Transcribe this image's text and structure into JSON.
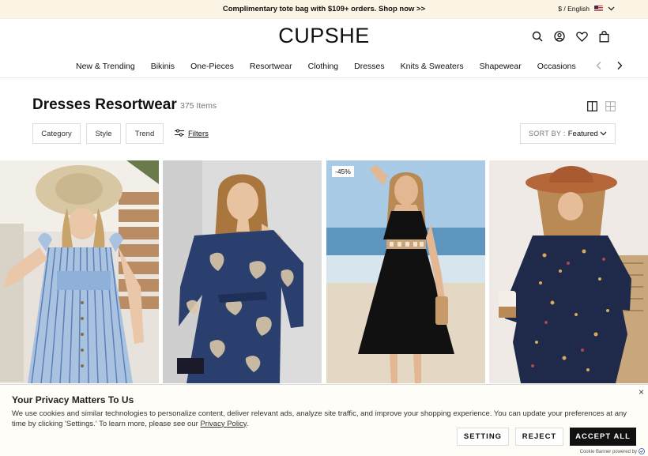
{
  "announcement": {
    "message": "Complimentary tote bag with $109+ orders. Shop now >>",
    "locale": "$ / English",
    "flag_icon": "us-flag-icon"
  },
  "header": {
    "logo": "CUPSHE",
    "icons": [
      "search-icon",
      "account-icon",
      "wishlist-icon",
      "bag-icon"
    ]
  },
  "nav": {
    "items": [
      "New & Trending",
      "Bikinis",
      "One-Pieces",
      "Resortwear",
      "Clothing",
      "Dresses",
      "Knits & Sweaters",
      "Shapewear",
      "Occasions"
    ],
    "prev_icon": "chevron-left-icon",
    "next_icon": "chevron-right-icon"
  },
  "page": {
    "title": "Dresses Resortwear",
    "count": "375 Items"
  },
  "filters": {
    "category": "Category",
    "style": "Style",
    "trend": "Trend",
    "filters_link": "Filters",
    "sort_label": "SORT BY :",
    "sort_value": "Featured"
  },
  "products": [
    {
      "badge": "",
      "image": "blue striped button-front dress with straw hat"
    },
    {
      "badge": "",
      "image": "navy leaf-print off-shoulder dress"
    },
    {
      "badge": "-45%",
      "image": "black sleeveless midi dress on beach"
    },
    {
      "badge": "",
      "image": "navy floral long-sleeve dress with brown hat"
    }
  ],
  "cookie": {
    "title": "Your Privacy Matters To Us",
    "text": "We use cookies and similar technologies to personalize content, deliver relevant ads, analyze site traffic, and improve your shopping experience. You can update your preferences at any time by clicking 'Settings.' To learn more, please see our ",
    "link": "Privacy Policy",
    "text_end": ".",
    "setting_btn": "SETTING",
    "reject_btn": "REJECT",
    "accept_btn": "ACCEPT ALL",
    "close": "×",
    "powered": "Cookie Banner powered by"
  },
  "colors": {
    "announcement_bg": "#fbf3e4",
    "accent": "#111111"
  }
}
